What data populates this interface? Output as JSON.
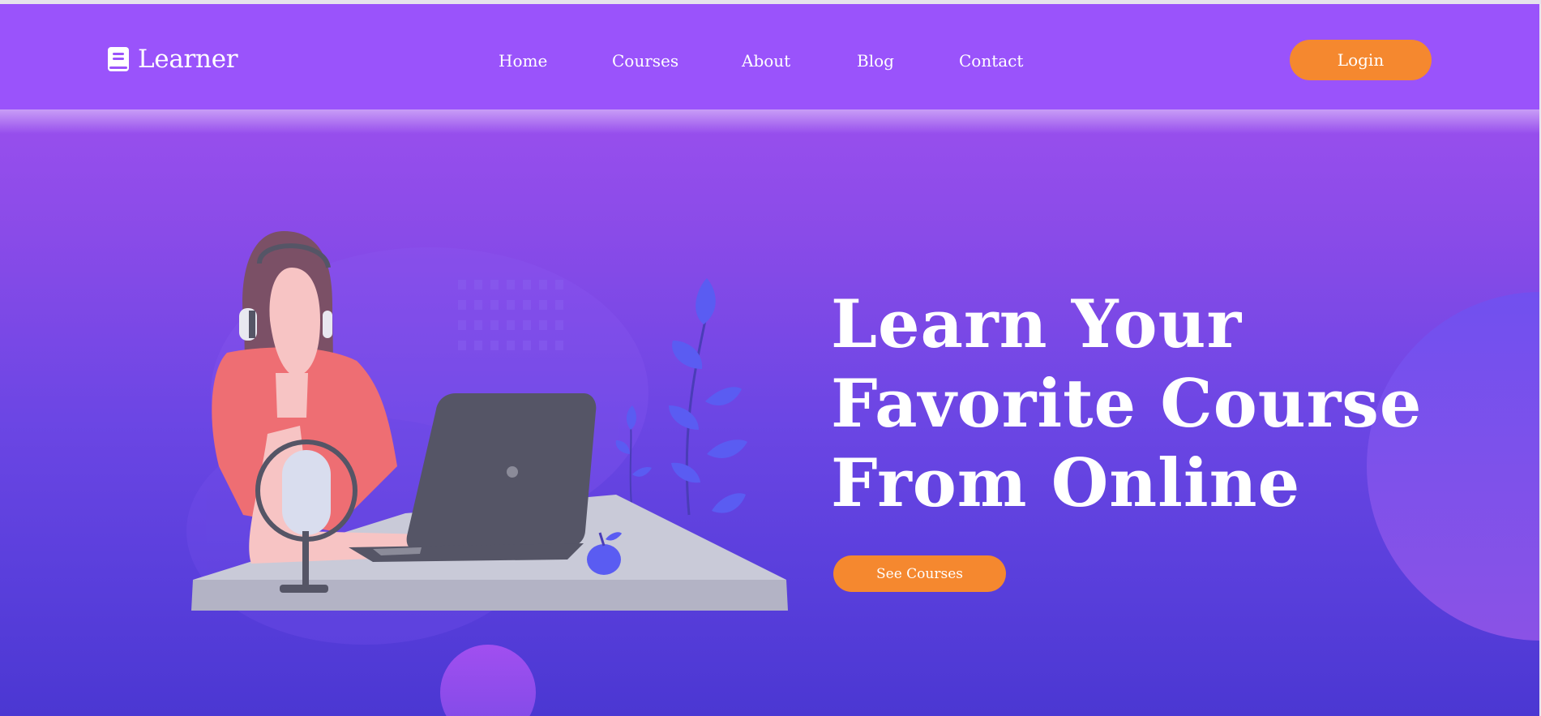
{
  "header": {
    "brand": {
      "name": "Learner",
      "icon": "book-icon"
    },
    "nav": [
      "Home",
      "Courses",
      "About",
      "Blog",
      "Contact"
    ],
    "login_label": "Login"
  },
  "hero": {
    "title_lines": [
      "Learn Your",
      "Favorite Course",
      "From Online"
    ],
    "cta_label": "See Courses",
    "illustration": "woman-at-laptop-with-headphones-and-microphone"
  },
  "colors": {
    "nav_bg": "#9a53fb",
    "accent": "#f5882f",
    "gradient_top": "#a04ff0",
    "gradient_bottom": "#4b37d2"
  }
}
